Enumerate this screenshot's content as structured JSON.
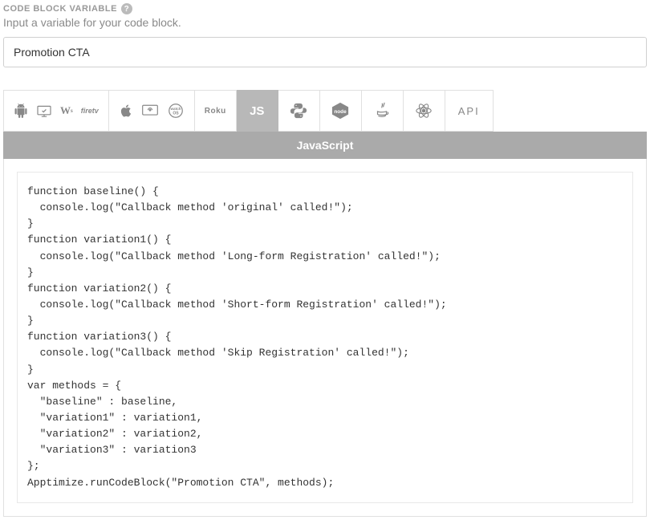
{
  "section": {
    "label": "CODE BLOCK VARIABLE",
    "description": "Input a variable for your code block."
  },
  "input": {
    "value": "Promotion CTA"
  },
  "tabs": {
    "api_label": "API",
    "active_language": "JavaScript"
  },
  "icons": {
    "android": "android",
    "androidtv": "androidtv",
    "wear": "W",
    "firetv": "firetv",
    "apple": "apple",
    "appletv": "appletv",
    "watchos": "watchOS",
    "roku": "Roku",
    "js": "JS",
    "python": "python",
    "node": "node",
    "java": "java",
    "react": "react"
  },
  "code": "function baseline() {\n  console.log(\"Callback method 'original' called!\");\n}\nfunction variation1() {\n  console.log(\"Callback method 'Long-form Registration' called!\");\n}\nfunction variation2() {\n  console.log(\"Callback method 'Short-form Registration' called!\");\n}\nfunction variation3() {\n  console.log(\"Callback method 'Skip Registration' called!\");\n}\nvar methods = {\n  \"baseline\" : baseline,\n  \"variation1\" : variation1,\n  \"variation2\" : variation2,\n  \"variation3\" : variation3\n};\nApptimize.runCodeBlock(\"Promotion CTA\", methods);"
}
